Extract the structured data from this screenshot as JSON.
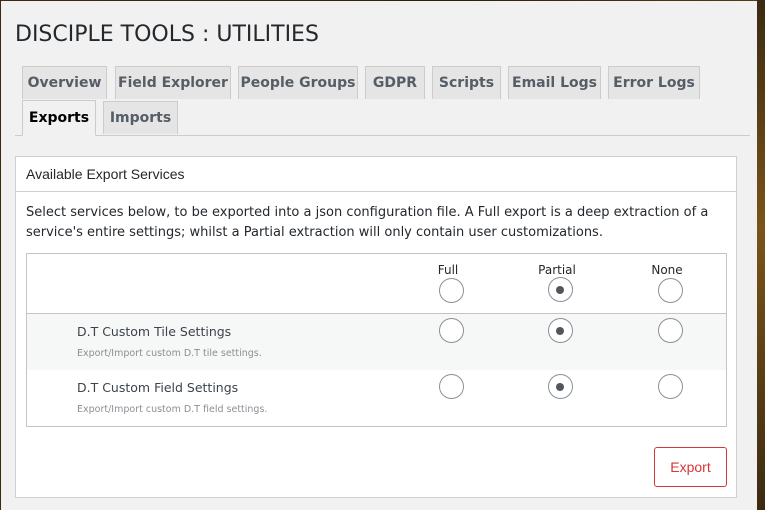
{
  "page": {
    "title": "DISCIPLE TOOLS : UTILITIES"
  },
  "tabs": [
    {
      "label": "Overview",
      "active": false
    },
    {
      "label": "Field Explorer",
      "active": false
    },
    {
      "label": "People Groups",
      "active": false
    },
    {
      "label": "GDPR",
      "active": false
    },
    {
      "label": "Scripts",
      "active": false
    },
    {
      "label": "Email Logs",
      "active": false
    },
    {
      "label": "Error Logs",
      "active": false
    },
    {
      "label": "Exports",
      "active": true
    },
    {
      "label": "Imports",
      "active": false
    }
  ],
  "panel": {
    "heading": "Available Export Services",
    "intro": "Select services below, to be exported into a json configuration file. A Full export is a deep extraction of a service's entire settings; whilst a Partial extraction will only contain user customizations.",
    "columns": [
      "Full",
      "Partial",
      "None"
    ],
    "select_all_choice": "Partial",
    "services": [
      {
        "name": "D.T Custom Tile Settings",
        "description": "Export/Import custom D.T tile settings.",
        "choice": "Partial"
      },
      {
        "name": "D.T Custom Field Settings",
        "description": "Export/Import custom D.T field settings.",
        "choice": "Partial"
      }
    ],
    "export_label": "Export"
  },
  "colors": {
    "export_accent": "#d63638",
    "page_background": "#f1f1f1"
  }
}
